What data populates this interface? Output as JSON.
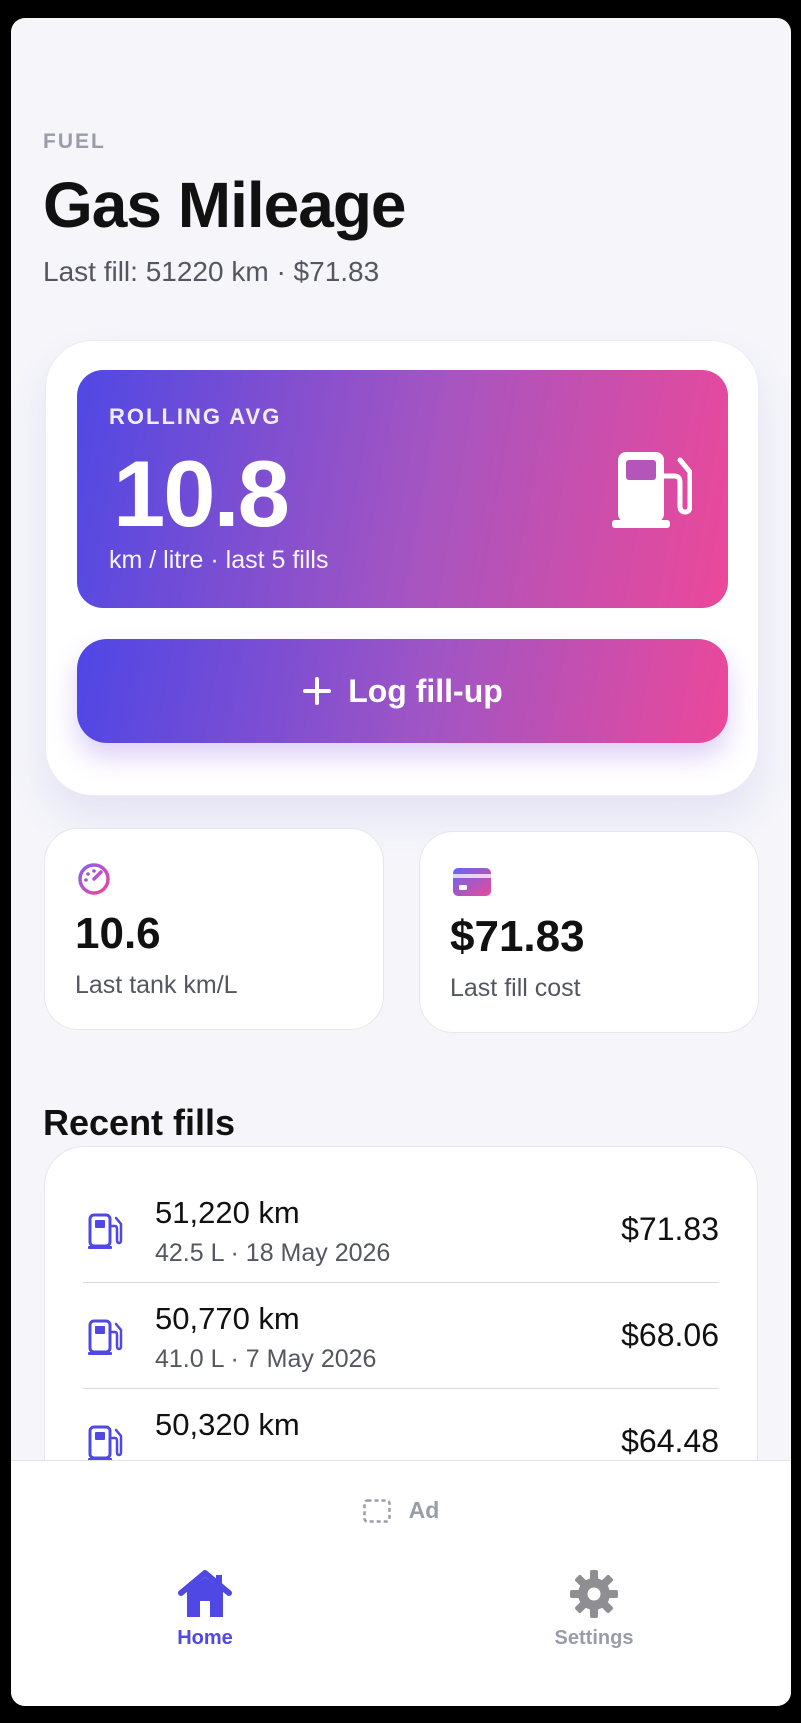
{
  "header": {
    "eyebrow": "FUEL",
    "title": "Gas Mileage",
    "subtitle": "Last fill: 51220 km · $71.83"
  },
  "hero": {
    "label": "ROLLING AVG",
    "value": "10.8",
    "unit": "km / litre · last 5 fills",
    "icon": "fuel-pump-icon"
  },
  "actions": {
    "log_label": "Log fill-up"
  },
  "stats": [
    {
      "icon": "speedometer-icon",
      "value": "10.6",
      "label": "Last tank km/L"
    },
    {
      "icon": "credit-card-icon",
      "value": "$71.83",
      "label": "Last fill cost"
    }
  ],
  "recent": {
    "title": "Recent fills",
    "items": [
      {
        "km": "51,220 km",
        "detail": "42.5 L · 18 May 2026",
        "cost": "$71.83"
      },
      {
        "km": "50,770 km",
        "detail": "41.0 L · 7 May 2026",
        "cost": "$68.06"
      },
      {
        "km": "50,320 km",
        "detail": "",
        "cost": "$64.48"
      }
    ]
  },
  "ad": {
    "label": "Ad"
  },
  "nav": {
    "tabs": [
      {
        "label": "Home",
        "icon": "home-icon",
        "active": true
      },
      {
        "label": "Settings",
        "icon": "gear-icon",
        "active": false
      }
    ]
  },
  "colors": {
    "accent": "#5048e4",
    "gradient_start": "#4f46e5",
    "gradient_end": "#ec4899",
    "inactive": "#9a9caa"
  }
}
